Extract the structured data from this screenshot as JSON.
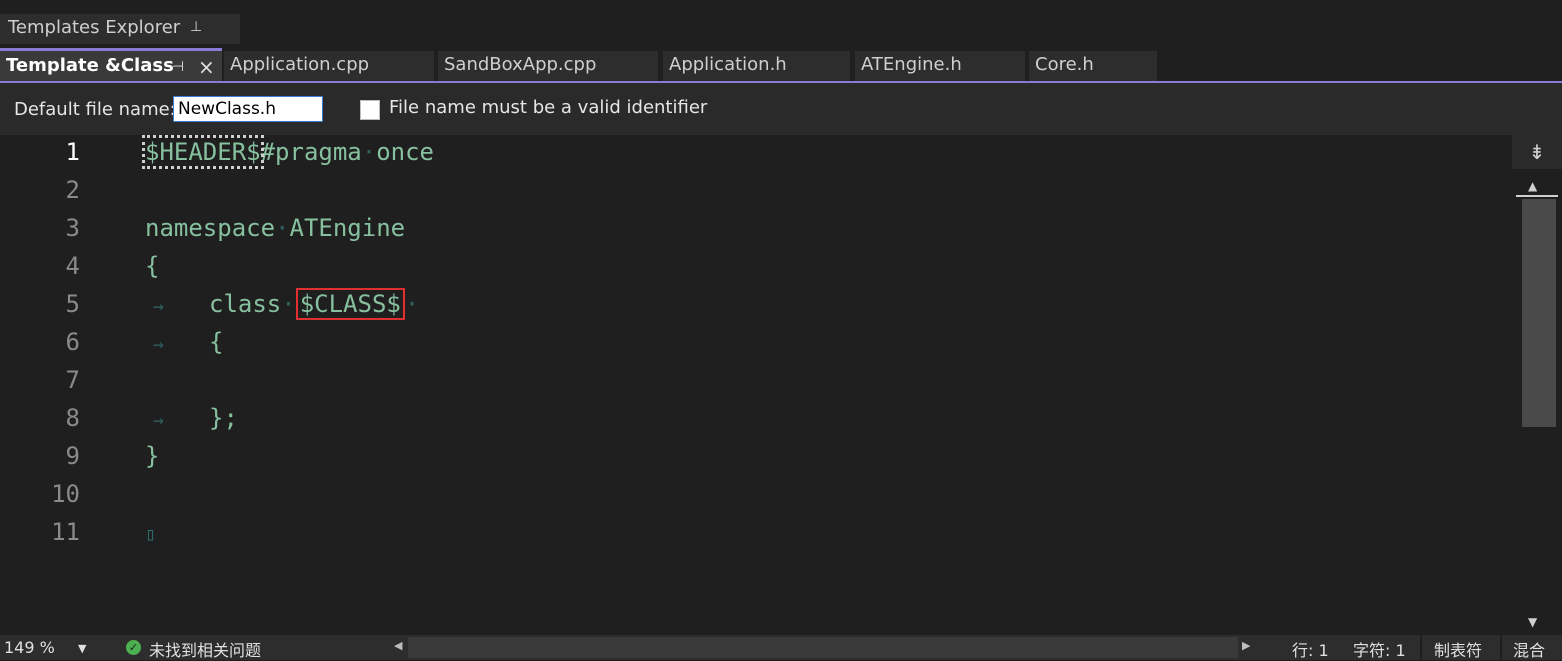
{
  "tool_window": {
    "title": "Templates Explorer",
    "pin_icon": "pin-icon"
  },
  "doc_tabs": [
    {
      "label": "Template &Class",
      "active": true
    },
    {
      "label": "Application.cpp"
    },
    {
      "label": "SandBoxApp.cpp"
    },
    {
      "label": "Application.h"
    },
    {
      "label": "ATEngine.h"
    },
    {
      "label": "Core.h"
    }
  ],
  "options": {
    "filename_label": "Default file name:",
    "filename_value": "NewClass.h",
    "checkbox_label": "File name must be a valid identifier",
    "checkbox_checked": false
  },
  "editor": {
    "line_numbers": [
      "1",
      "2",
      "3",
      "4",
      "5",
      "6",
      "7",
      "8",
      "9",
      "10",
      "11"
    ],
    "current_line": "1",
    "tokens": {
      "header": "$HEADER$",
      "pragma": "#pragma",
      "once": "once",
      "namespace_kw": "namespace",
      "namespace_name": "ATEngine",
      "open_brace": "{",
      "class_kw": "class",
      "class_token": "$CLASS$",
      "class_open": "{",
      "class_close": "};",
      "close_brace": "}"
    }
  },
  "status_bar": {
    "zoom": "149 %",
    "issues": "未找到相关问题",
    "line": "行: 1",
    "char": "字符: 1",
    "indent_mode": "制表符",
    "line_ending": "混合"
  },
  "colors": {
    "accent": "#8b7bd8",
    "code_text": "#87c09f",
    "highlight_box": "#e03030",
    "status_ok": "#4caf50"
  }
}
